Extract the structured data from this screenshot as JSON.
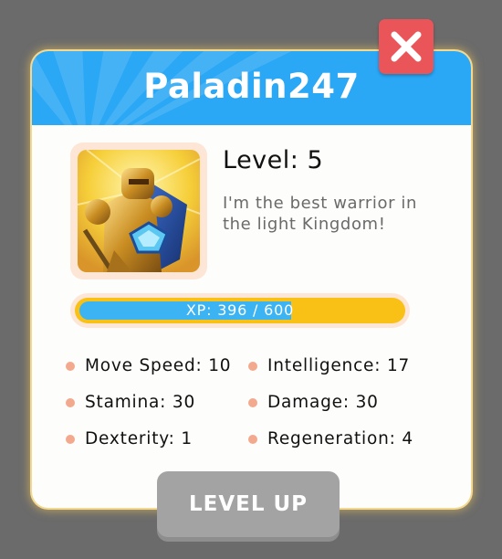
{
  "window": {
    "title": "Paladin247",
    "close_icon": "close-x-icon"
  },
  "profile": {
    "avatar_icon": "paladin-knight-portrait",
    "level_text": "Level: 5",
    "bio": "I'm the best warrior in the light Kingdom!"
  },
  "xp": {
    "label": "XP: 396 / 600",
    "current": 396,
    "max": 600
  },
  "stats": [
    {
      "label": "Move Speed: 10"
    },
    {
      "label": "Intelligence: 17"
    },
    {
      "label": "Stamina: 30"
    },
    {
      "label": "Damage: 30"
    },
    {
      "label": "Dexterity: 1"
    },
    {
      "label": "Regeneration: 4"
    }
  ],
  "actions": {
    "level_up_label": "LEVEL UP"
  },
  "colors": {
    "header": "#2aa7f5",
    "close_button": "#ea5559",
    "xp_fill": "#3cb3f2",
    "xp_track": "#f9c115",
    "stat_bullet": "#f2a98e",
    "level_up_button": "#a3a3a3"
  }
}
